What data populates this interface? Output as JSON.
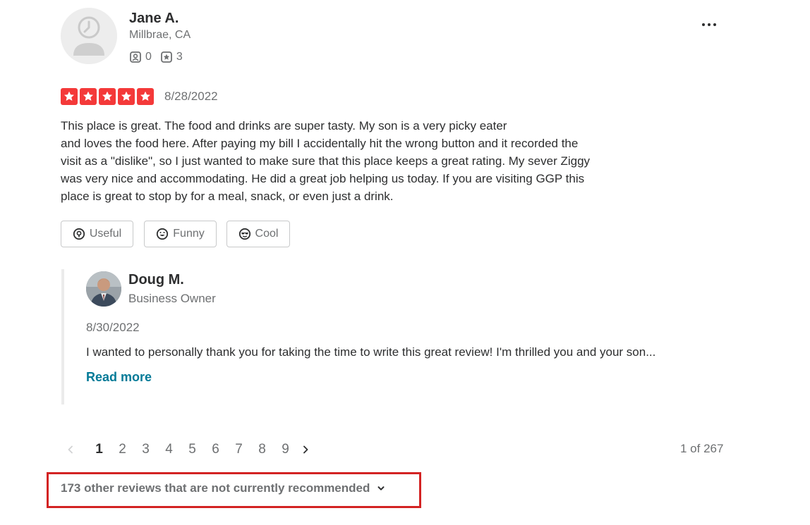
{
  "review": {
    "user": {
      "name": "Jane A.",
      "location": "Millbrae, CA",
      "friends_count": "0",
      "reviews_count": "3",
      "avatar_icon": "default-user-icon"
    },
    "rating": 5,
    "date": "8/28/2022",
    "text_lines": [
      "This place is great. The food and drinks are super tasty. My son is a very picky eater",
      "and loves the food here. After paying my bill I accidentally hit the wrong button and it recorded the",
      "visit as a \"dislike\", so I just wanted to make sure that this place keeps a great rating. My sever Ziggy",
      "was very nice and accommodating. He did a great job helping us today. If you are visiting GGP this",
      "place is great to stop by for a meal, snack, or even just a drink."
    ],
    "reactions": {
      "useful": "Useful",
      "funny": "Funny",
      "cool": "Cool"
    },
    "more_icon": "more-dots-icon"
  },
  "owner_reply": {
    "name": "Doug M.",
    "role": "Business Owner",
    "date": "8/30/2022",
    "text": "I wanted to personally thank you for taking the time to write this great review! I'm thrilled you and your son...",
    "read_more": "Read more"
  },
  "pagination": {
    "pages": [
      "1",
      "2",
      "3",
      "4",
      "5",
      "6",
      "7",
      "8",
      "9"
    ],
    "current": "1",
    "count_label": "1 of 267"
  },
  "not_recommended": {
    "label": "173 other reviews that are not currently recommended",
    "icon": "chevron-down-icon"
  },
  "colors": {
    "star_red": "#f43939",
    "link_teal": "#027a97",
    "highlight_box": "#d32323",
    "text_dark": "#2d2e2f",
    "text_muted": "#6e7072"
  }
}
